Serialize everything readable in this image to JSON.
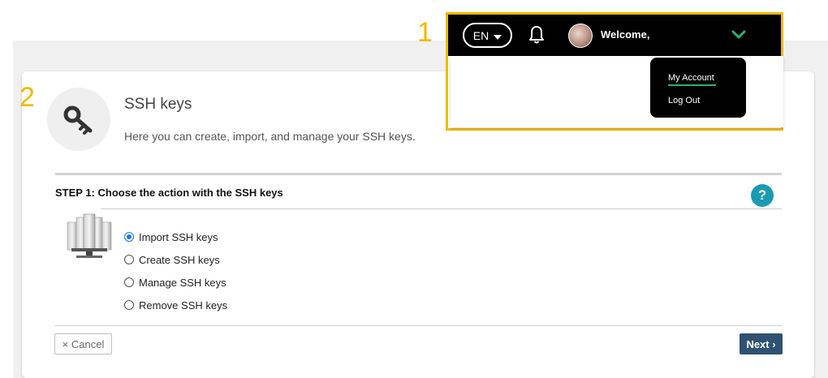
{
  "callouts": {
    "header": "1",
    "content": "2"
  },
  "header": {
    "language": "EN",
    "welcome": "Welcome,",
    "menu": [
      "My Account",
      "Log Out"
    ]
  },
  "page": {
    "title": "SSH keys",
    "description": "Here you can create, import, and manage your SSH keys."
  },
  "step": {
    "label": "STEP 1:  Choose the action with the SSH keys",
    "help": "?",
    "options": [
      {
        "label": "Import SSH keys",
        "checked": true
      },
      {
        "label": "Create SSH keys",
        "checked": false
      },
      {
        "label": "Manage SSH keys",
        "checked": false
      },
      {
        "label": "Remove SSH keys",
        "checked": false
      }
    ]
  },
  "buttons": {
    "cancel": "× Cancel",
    "next": "Next ›"
  },
  "colors": {
    "callout": "#f5b800",
    "next_button": "#2f5272",
    "help_button": "#1a9bb3",
    "menu_accent": "#2ab36c"
  },
  "icons": [
    "key-icon",
    "servers-icon",
    "bell-icon",
    "chevron-down-icon",
    "caret-down-icon",
    "avatar"
  ]
}
